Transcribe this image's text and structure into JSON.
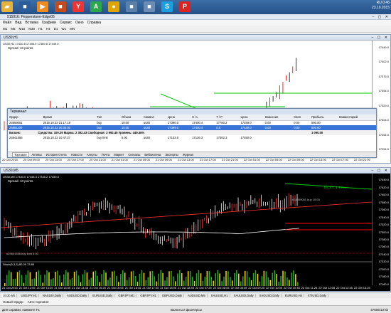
{
  "taskbar": {
    "apps": [
      {
        "name": "folder-icon",
        "glyph": "▰",
        "color": "#e7b13a"
      },
      {
        "name": "app-icon",
        "glyph": "■",
        "color": "#2b5d9b"
      },
      {
        "name": "media-player-icon",
        "glyph": "▶",
        "color": "#f28b1e"
      },
      {
        "name": "app-icon",
        "glyph": "■",
        "color": "#c44b1e"
      },
      {
        "name": "yandex-icon",
        "glyph": "Y",
        "color": "#e33"
      },
      {
        "name": "app-icon",
        "glyph": "A",
        "color": "#2aa84a"
      },
      {
        "name": "chrome-icon",
        "glyph": "●",
        "color": "#e2a400"
      },
      {
        "name": "app-icon",
        "glyph": "■",
        "color": "#5a7fa8"
      },
      {
        "name": "app-icon",
        "glyph": "■",
        "color": "#6b8cb5"
      },
      {
        "name": "skype-icon",
        "glyph": "S",
        "color": "#1aa0e0"
      },
      {
        "name": "app-icon",
        "glyph": "P",
        "color": "#d22"
      }
    ],
    "tray_lang": "RU",
    "time": "0:46",
    "date": "23.10.2015"
  },
  "window_title": "515916: Pepperstone-Edge05",
  "menu": [
    "Файл",
    "Вид",
    "Вставка",
    "Графики",
    "Сервис",
    "Окно",
    "Справка"
  ],
  "timeframes": [
    "M1",
    "M5",
    "M15",
    "M30",
    "H1",
    "H4",
    "D1",
    "W1",
    "MN"
  ],
  "chart_h1": {
    "title": "US30,H1",
    "quote": "US30,H1  17430.8 17456.0 17389.8 17449.0",
    "spread": "Spread: 10 points.",
    "prices": [
      "17449.0",
      "17402.0",
      "17375.5",
      "17354.0",
      "17329.0",
      "17304.0",
      "17254.0",
      "17254.5"
    ],
    "times": [
      "20 Oct 2015",
      "20 Oct 09:00",
      "20 Oct 13:00",
      "20 Oct 17:00",
      "20 Oct 21:00",
      "21 Oct 01:00",
      "21 Oct 05:00",
      "21 Oct 09:00",
      "21 Oct 13:00",
      "21 Oct 17:00",
      "21 Oct 21:00",
      "22 Oct 01:00",
      "22 Oct 05:00",
      "22 Oct 09:00",
      "22 Oct 13:00",
      "22 Oct 17:00",
      "22 Oct 21:00"
    ]
  },
  "terminal": {
    "title": "Терминал",
    "headers": [
      "Ордер",
      "",
      "Время",
      "Тип",
      "Объем",
      "Символ",
      "Цена",
      "S / L",
      "T / P",
      "Цена",
      "Комиссия",
      "Своп",
      "Прибыль",
      "Комментарий"
    ],
    "rows": [
      [
        "24859051",
        "",
        "2015.10.22 21:17:19",
        "buy",
        "10.00",
        "us30",
        "17390.0",
        "17400.4",
        "17780.2",
        "17449.0",
        "0.00",
        "0.00",
        "590.00",
        ""
      ],
      [
        "24851100",
        "",
        "2015.10.22 20:30:00",
        "buy",
        "10.00",
        "us30",
        "17399.0",
        "17400.4",
        "0.0",
        "17449.0",
        "0.00",
        "0.00",
        "500.00",
        ""
      ]
    ],
    "balance_row": {
      "label": "Баланс:",
      "text": "Средства: 100.29  Маржа: 2 392.43  Свободная: 3 992.45  Уровень: 449.46%",
      "profit": "1 090.00"
    },
    "pending_row": [
      "24841556",
      "",
      "2015.10.22 10:47:27",
      "buy limit",
      "5.00",
      "us30",
      "17133.0",
      "17126.3",
      "17302.3",
      "17450.0",
      "",
      "",
      "",
      ""
    ],
    "tabs": [
      "Торговля",
      "Активы",
      "История Счета",
      "Новости",
      "Алерты",
      "Почта",
      "Маркет",
      "Сигналы",
      "Библиотека",
      "Эксперты",
      "Журнал"
    ],
    "active_tab": "Торговля"
  },
  "chart_m5": {
    "title": "US30,M5",
    "quote": "US30,M5  17440.0 17448.3 17440.2 17449.0",
    "spread": "Spread: 10 points.",
    "annotation_1": "D\\Ch:c,:1.73 %",
    "annotation_2": "#24859051 buy 10.00",
    "annotation_3": "#24841556 buy limit 5.00",
    "indicator_label": "Stoch(5,3,3) 80.25 73.85",
    "prices": [
      "17449.0",
      "17420.0",
      "17400.0",
      "17380.0",
      "17360.0",
      "17340.0",
      "17320.0",
      "17300.0",
      "17280.0",
      "17260.0",
      "17240.0",
      "17220.0",
      "17200.0",
      "17180.0",
      "17160.0"
    ],
    "times": [
      "21 Oct 2015",
      "21 Oct 12:05",
      "21 Oct 13:25",
      "21 Oct 14:05",
      "21 Oct 14:45",
      "21 Oct 15:25",
      "21 Oct 16:05",
      "21 Oct 16:45",
      "21 Oct 17:25",
      "21 Oct 18:05",
      "21 Oct 18:45",
      "22 Oct 07:25",
      "22 Oct 08:05",
      "22 Oct 08:45",
      "22 Oct 09:25",
      "22 Oct 10:05",
      "22 Oct 10:45",
      "22 Oct 11:25",
      "22 Oct 12:05",
      "22 Oct 12:45",
      "22 Oct 13:25"
    ]
  },
  "chart_tabs": [
    "US30,M5",
    "USDJPY,H1",
    "NAS100,Daily",
    "AUDUSD,Daily",
    "EURUSD,Daily",
    "GBPJPY,M1",
    "GBPJPY,H1",
    "GBPUSD,Daily",
    "AUDUSD,M5",
    "XAUUSD,H1",
    "XAUUSD,Daily",
    "XAGUSD,Daily",
    "EURUSD,H4",
    "XTIUSD,Daily"
  ],
  "active_chart_tab": "US30,M5",
  "order_toolbar": [
    "Новый Ордер",
    "Авто-торговля"
  ],
  "status": {
    "help": "Для справки, нажмите F1",
    "profile": "Валюты и фьючерсы",
    "traffic": "47606/13 kb"
  },
  "colors": {
    "bull": "#ffffff",
    "bear": "#ff0000",
    "trend": "#00cc00",
    "bg_dark": "#000000"
  }
}
